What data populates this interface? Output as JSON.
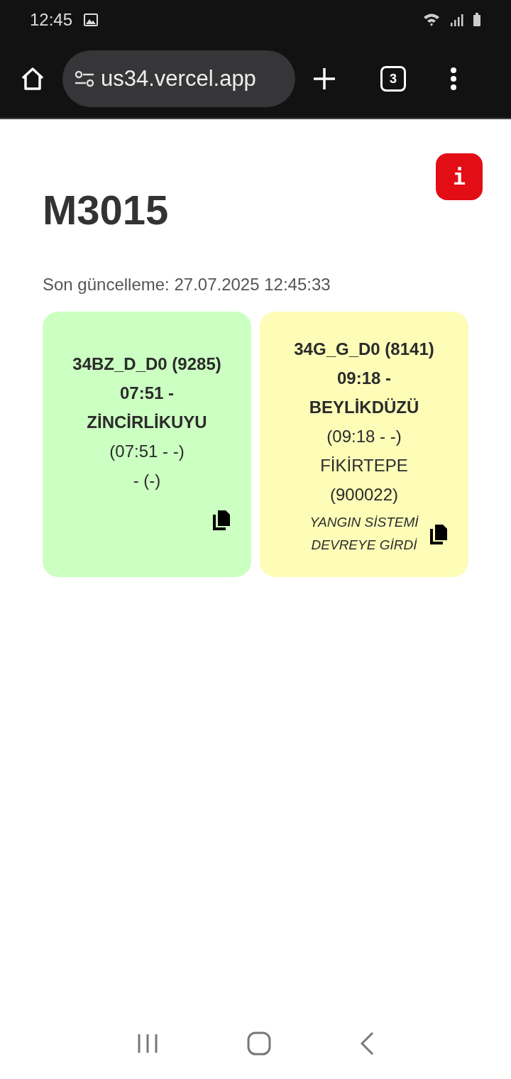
{
  "status_bar": {
    "time": "12:45"
  },
  "browser": {
    "url": "us34.vercel.app",
    "tab_count": "3"
  },
  "page": {
    "info_button": "i",
    "title": "M3015",
    "updated": "Son güncelleme: 27.07.2025 12:45:33",
    "cards": [
      {
        "color": "#ccffc2",
        "title": "34BZ_D_D0 (9285) 07:51 - ZİNCİRLİKUYU",
        "time_range": "(07:51 - -)",
        "stop": "- (-)"
      },
      {
        "color": "#fdfdb8",
        "title": "34G_G_D0 (8141) 09:18 - BEYLİKDÜZÜ",
        "time_range": "(09:18 - -)",
        "stop": "FİKİRTEPE (900022)",
        "note": "YANGIN SİSTEMİ DEVREYE GİRDİ"
      }
    ]
  }
}
